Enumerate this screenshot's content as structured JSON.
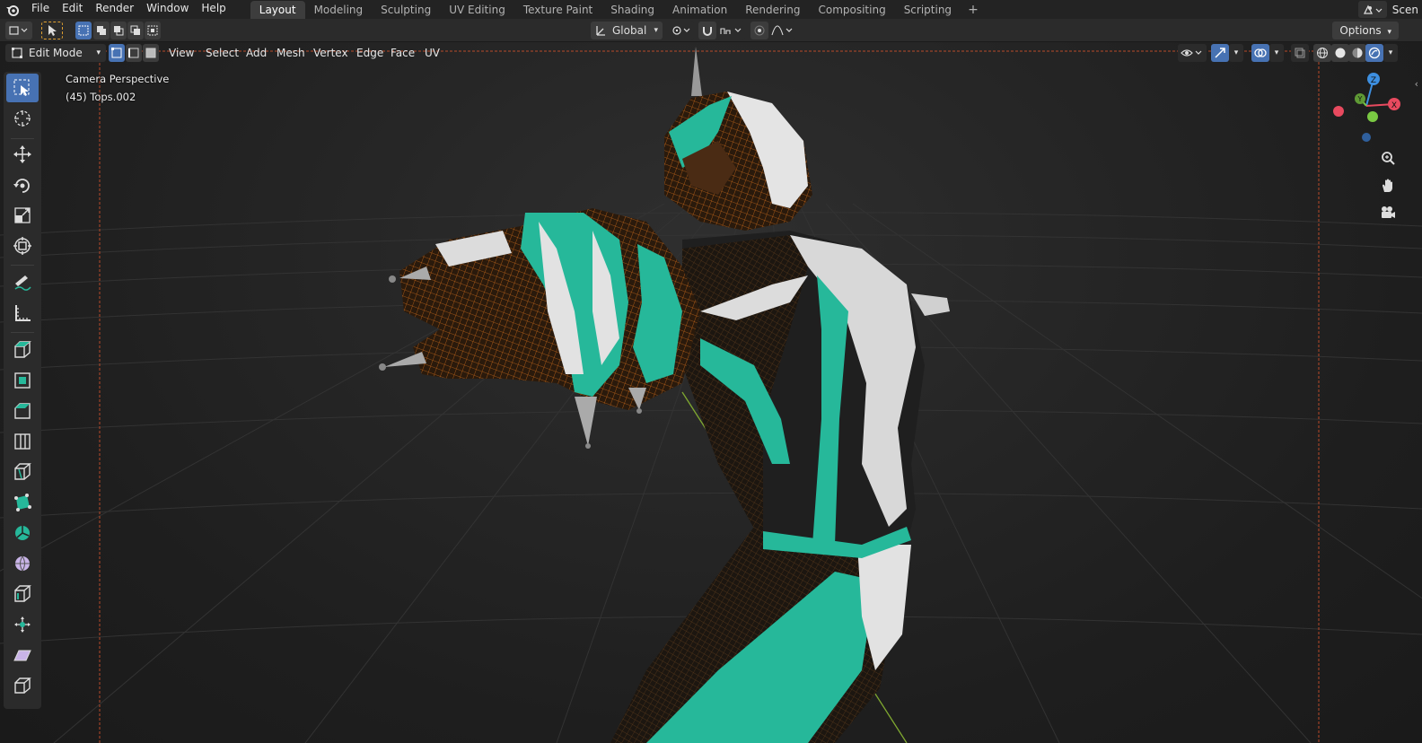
{
  "topbar": {
    "menus": [
      "File",
      "Edit",
      "Render",
      "Window",
      "Help"
    ],
    "workspaces": [
      "Layout",
      "Modeling",
      "Sculpting",
      "UV Editing",
      "Texture Paint",
      "Shading",
      "Animation",
      "Rendering",
      "Compositing",
      "Scripting"
    ],
    "active_workspace": "Layout",
    "add_tab": "+",
    "scene_label": "Scen"
  },
  "toolheader": {
    "orientation": "Global",
    "options": "Options"
  },
  "viewport_header": {
    "mode": "Edit Mode",
    "menus": [
      "View",
      "Select",
      "Add",
      "Mesh",
      "Vertex",
      "Edge",
      "Face",
      "UV"
    ]
  },
  "viewport": {
    "camera_label": "Camera Perspective",
    "object_label": "(45) Tops.002"
  },
  "gizmo": {
    "x_label": "X",
    "y_label": "Y",
    "z_label": "Z",
    "x_color": "#e84a5f",
    "y_color": "#7ac943",
    "z_color": "#3d8fe0"
  },
  "colors": {
    "accent": "#4772b3",
    "mesh_selected": "#e07a1f",
    "mesh_teal": "#26b89a",
    "mesh_white": "#e2e2e2"
  }
}
